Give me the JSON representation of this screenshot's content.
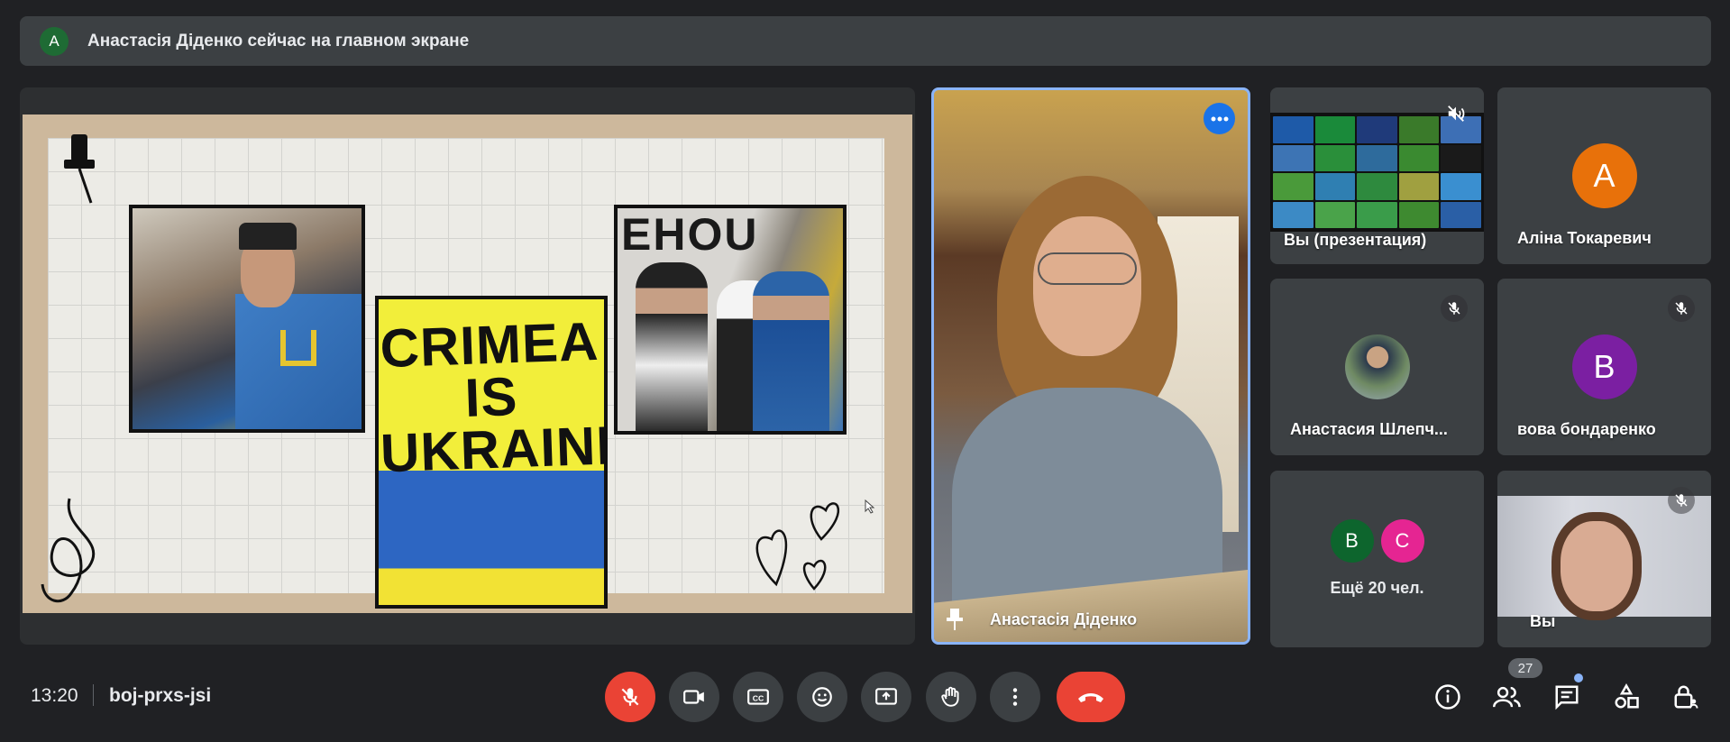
{
  "banner": {
    "avatar_letter": "А",
    "text": "Анастасія Діденко сейчас на главном экране",
    "avatar_color": "#1e6b34"
  },
  "slide": {
    "sign_line1": "CRIMEA",
    "sign_line2": "IS",
    "sign_line3": "UKRAINE",
    "wall_text": "EHOU"
  },
  "speaker": {
    "name": "Анастасія Діденко"
  },
  "tiles": [
    {
      "name": "Вы (презентация)"
    },
    {
      "name": "Аліна Токаревич",
      "avatar_letter": "А",
      "avatar_color": "#e8710a"
    },
    {
      "name": "Анастасия Шлепч..."
    },
    {
      "name": "вова бондаренко",
      "avatar_letter": "В",
      "avatar_color": "#7b1fa2"
    },
    {
      "label": "Ещё 20 чел.",
      "avatars": [
        {
          "letter": "В",
          "color": "#0d652d"
        },
        {
          "letter": "С",
          "color": "#e52592"
        }
      ]
    },
    {
      "name": "Вы"
    }
  ],
  "bottom_bar": {
    "time": "13:20",
    "meeting_code": "boj-prxs-jsi",
    "participants_count": "27"
  },
  "colors": {
    "background": "#202124",
    "tile": "#3c4043",
    "danger": "#ea4335",
    "accent": "#8ab4f8"
  }
}
